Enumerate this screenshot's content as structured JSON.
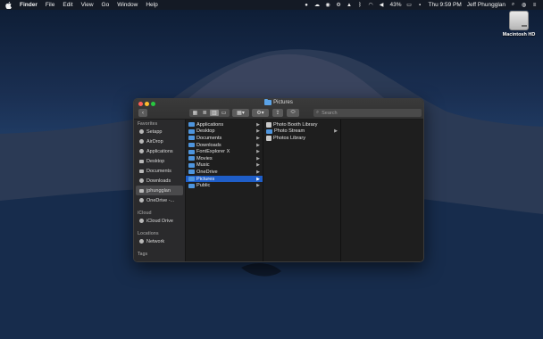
{
  "menubar": {
    "app_name": "Finder",
    "menus": [
      "File",
      "Edit",
      "View",
      "Go",
      "Window",
      "Help"
    ],
    "battery": "43%",
    "datetime": "Thu 9:59 PM",
    "user": "Jeff Phungglan"
  },
  "desktop": {
    "drive_label": "Macintosh HD"
  },
  "window": {
    "title": "Pictures",
    "search_placeholder": "Search"
  },
  "sidebar": {
    "favorites_heading": "Favorites",
    "favorites": [
      {
        "label": "Setapp",
        "icon": "setapp-icon"
      },
      {
        "label": "AirDrop",
        "icon": "airdrop-icon"
      },
      {
        "label": "Applications",
        "icon": "applications-icon"
      },
      {
        "label": "Desktop",
        "icon": "desktop-icon"
      },
      {
        "label": "Documents",
        "icon": "documents-icon"
      },
      {
        "label": "Downloads",
        "icon": "downloads-icon"
      },
      {
        "label": "jphungglan",
        "icon": "home-icon"
      },
      {
        "label": "OneDrive -...",
        "icon": "cloud-icon"
      }
    ],
    "icloud_heading": "iCloud",
    "icloud": [
      {
        "label": "iCloud Drive",
        "icon": "icloud-icon"
      }
    ],
    "locations_heading": "Locations",
    "locations": [
      {
        "label": "Network",
        "icon": "network-icon"
      }
    ],
    "tags_heading": "Tags"
  },
  "columns": {
    "home": [
      {
        "label": "Applications",
        "has_children": true
      },
      {
        "label": "Desktop",
        "has_children": true
      },
      {
        "label": "Documents",
        "has_children": true
      },
      {
        "label": "Downloads",
        "has_children": true
      },
      {
        "label": "FontExplorer X",
        "has_children": true
      },
      {
        "label": "Movies",
        "has_children": true
      },
      {
        "label": "Music",
        "has_children": true
      },
      {
        "label": "OneDrive",
        "has_children": true
      },
      {
        "label": "Pictures",
        "has_children": true,
        "selected": true
      },
      {
        "label": "Public",
        "has_children": true
      }
    ],
    "pictures": [
      {
        "label": "Photo Booth Library",
        "has_children": false
      },
      {
        "label": "Photo Stream",
        "has_children": true
      },
      {
        "label": "Photos Library",
        "has_children": false
      }
    ]
  },
  "colors": {
    "selection": "#1f5ec8",
    "folder": "#4e95de",
    "close": "#ff5f57",
    "minimize": "#febc2e",
    "maximize": "#28c840"
  }
}
